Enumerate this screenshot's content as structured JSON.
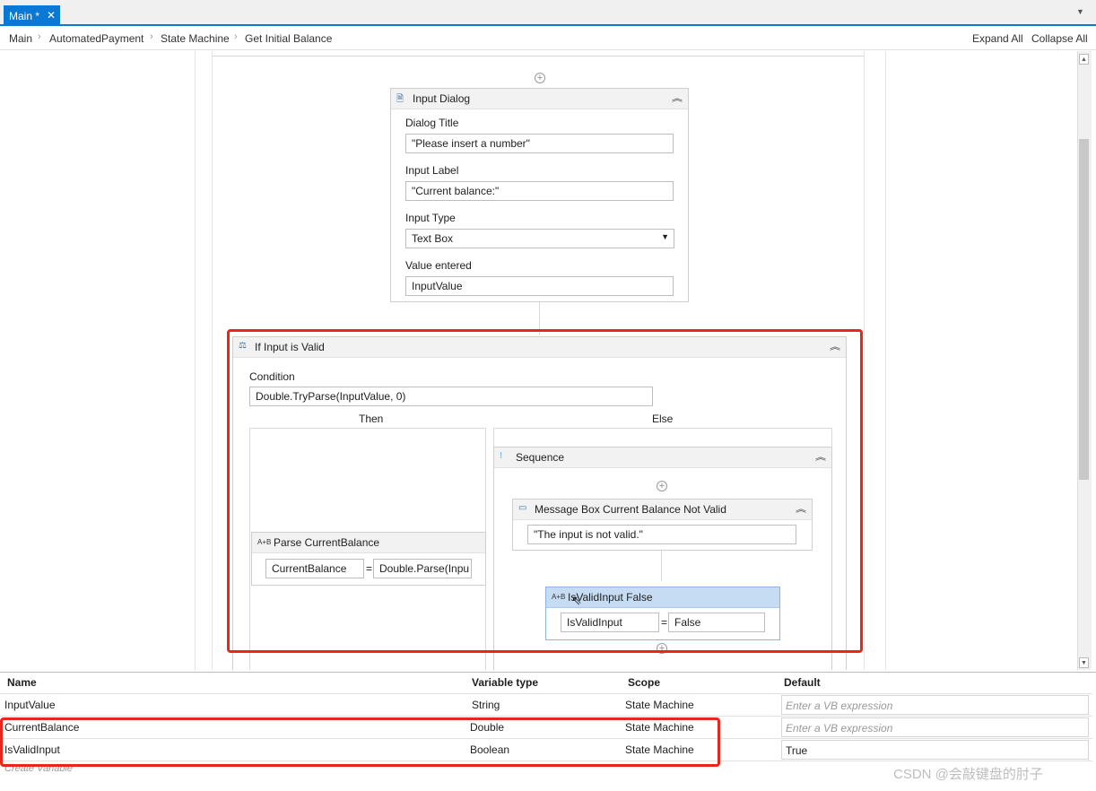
{
  "tabs": [
    {
      "label": "Main *"
    }
  ],
  "breadcrumb": [
    "Main",
    "AutomatedPayment",
    "State Machine",
    "Get Initial Balance"
  ],
  "toolbar": {
    "expand_all": "Expand All",
    "collapse_all": "Collapse All"
  },
  "input_dialog": {
    "title": "Input Dialog",
    "dialog_title_label": "Dialog Title",
    "dialog_title_value": "\"Please insert a number\"",
    "input_label_label": "Input Label",
    "input_label_value": "\"Current balance:\"",
    "input_type_label": "Input Type",
    "input_type_value": "Text Box",
    "value_entered_label": "Value entered",
    "value_entered_value": "InputValue"
  },
  "if_activity": {
    "title": "If Input is Valid",
    "condition_label": "Condition",
    "condition_value": "Double.TryParse(InputValue, 0)",
    "then_label": "Then",
    "else_label": "Else"
  },
  "parse_assign": {
    "title": "Parse CurrentBalance",
    "to": "CurrentBalance",
    "value": "Double.Parse(Inpu"
  },
  "sequence": {
    "title": "Sequence"
  },
  "message_box": {
    "title": "Message Box Current Balance Not Valid",
    "text": "\"The input is not valid.\""
  },
  "isvalid_assign": {
    "title": "IsValidInput False",
    "to": "IsValidInput",
    "value": "False"
  },
  "variables": {
    "headers": [
      "Name",
      "Variable type",
      "Scope",
      "Default"
    ],
    "rows": [
      {
        "name": "InputValue",
        "type": "String",
        "scope": "State Machine",
        "default": "Enter a VB expression"
      },
      {
        "name": "CurrentBalance",
        "type": "Double",
        "scope": "State Machine",
        "default": "Enter a VB expression"
      },
      {
        "name": "IsValidInput",
        "type": "Boolean",
        "scope": "State Machine",
        "default": "True"
      }
    ],
    "create_variable": "Create Variable"
  },
  "watermark": "CSDN @会敲键盘的肘子",
  "colors": {
    "accent": "#0a78d4",
    "highlight": "#e8261e",
    "selected_header": "#c5dcf3"
  }
}
